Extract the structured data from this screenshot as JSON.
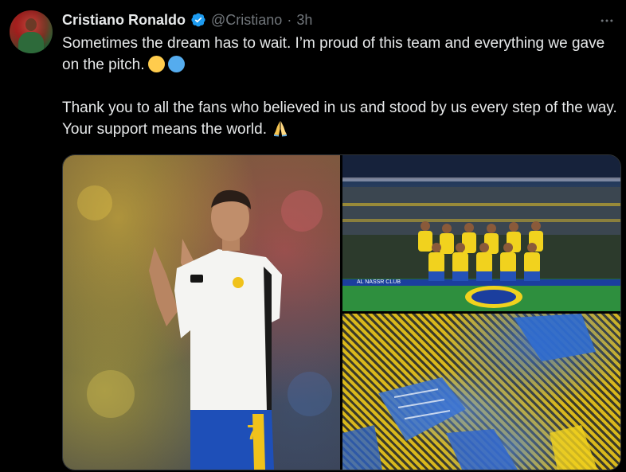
{
  "author": {
    "display_name": "Cristiano Ronaldo",
    "handle": "@Cristiano",
    "separator": "·",
    "timestamp": "3h",
    "verified_icon": "verified-badge-icon",
    "verified_color": "#1d9bf0"
  },
  "tweet": {
    "line_1": "Sometimes the dream has to wait. I’m proud of this team and everything we gave on the pitch.",
    "line_2": "Thank you to all the fans who believed in us and stood by us every step of the way. Your support means the world."
  },
  "emojis": {
    "yellow_circle": "#ffcc4d",
    "blue_circle": "#55acee",
    "pray_icon": "folded-hands-icon"
  },
  "icons": {
    "more": "more-options-icon"
  },
  "colors": {
    "background": "#000000",
    "text_primary": "#e7e9ea",
    "text_secondary": "#71767b",
    "border": "#2f3336"
  },
  "media": {
    "photos": [
      {
        "description": "player-applauding"
      },
      {
        "description": "team-photo"
      },
      {
        "description": "fans-with-flags"
      }
    ],
    "overlay_texts": {
      "shirt_number": "7",
      "ad_board": "AL NASSR CLUB"
    }
  }
}
